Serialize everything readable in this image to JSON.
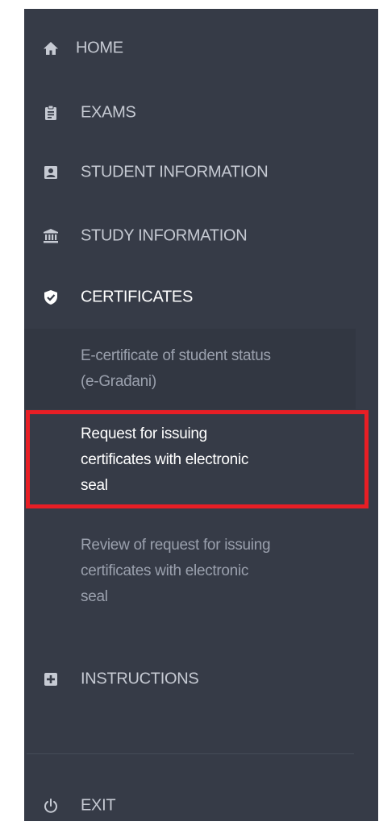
{
  "sidebar": {
    "items": [
      {
        "label": "HOME",
        "icon": "home-icon"
      },
      {
        "label": "EXAMS",
        "icon": "clipboard-icon"
      },
      {
        "label": "STUDENT INFORMATION",
        "icon": "id-card-icon"
      },
      {
        "label": "STUDY INFORMATION",
        "icon": "university-icon"
      },
      {
        "label": "CERTIFICATES",
        "icon": "shield-check-icon"
      },
      {
        "label": "INSTRUCTIONS",
        "icon": "plus-square-icon"
      }
    ],
    "certificates_submenu": [
      {
        "line1": "E-certificate of student status",
        "line2": "(e-Građani)",
        "line3": ""
      },
      {
        "line1": "Request for issuing",
        "line2": "certificates with electronic",
        "line3": "seal"
      },
      {
        "line1": "Review of request for issuing",
        "line2": "certificates with electronic",
        "line3": "seal"
      }
    ],
    "exit": {
      "label": "EXIT",
      "icon": "power-icon"
    }
  },
  "colors": {
    "sidebar_bg": "#363b47",
    "submenu_bg": "#323742",
    "text_default": "#c6cad3",
    "text_active": "#ffffff",
    "submenu_text": "#9aa0ad",
    "highlight_border": "#e81e25"
  }
}
